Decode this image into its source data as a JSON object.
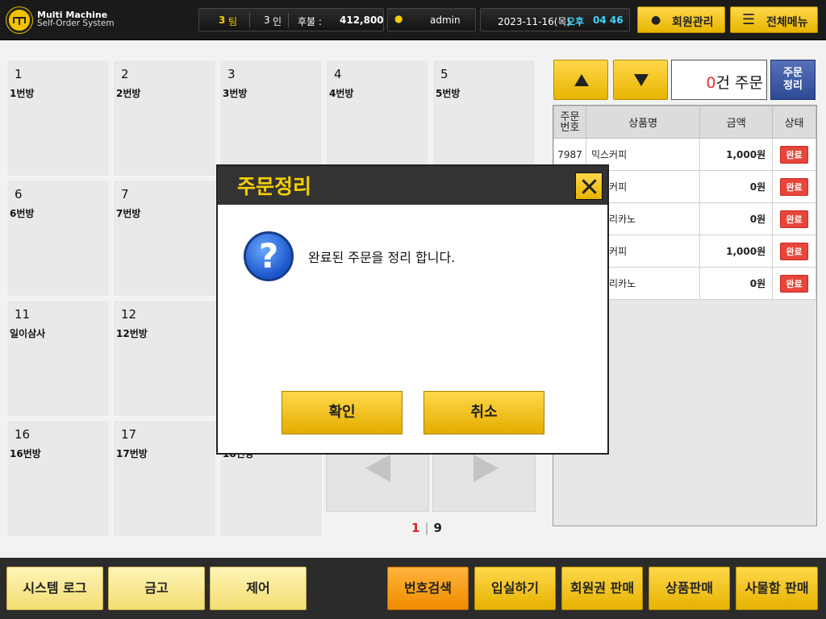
{
  "brand": {
    "line1": "Multi Machine",
    "line2": "Self-Order System"
  },
  "header": {
    "teams_value": "3",
    "teams_unit": "팀",
    "persons_value": "3",
    "persons_unit": "인",
    "postpaid_label": "후불 :",
    "postpaid_value": "412,800",
    "user": "admin",
    "date": "2023-11-16(목)",
    "ampm": "오후",
    "time": "04 46",
    "member_btn": "회원관리",
    "menu_btn": "전체메뉴"
  },
  "rooms": [
    {
      "num": "1",
      "name": "1번방"
    },
    {
      "num": "2",
      "name": "2번방"
    },
    {
      "num": "3",
      "name": "3번방"
    },
    {
      "num": "4",
      "name": "4번방"
    },
    {
      "num": "5",
      "name": "5번방"
    },
    {
      "num": "6",
      "name": "6번방"
    },
    {
      "num": "7",
      "name": "7번방"
    },
    {
      "num": "11",
      "name": "일이삼사"
    },
    {
      "num": "12",
      "name": "12번방"
    },
    {
      "num": "16",
      "name": "16번방"
    },
    {
      "num": "17",
      "name": "17번방"
    },
    {
      "num": "",
      "name": "18번방"
    }
  ],
  "pager": {
    "current": "1",
    "total": "9"
  },
  "orders_panel": {
    "count": "0",
    "count_suffix": "건 주문",
    "arrange_line1": "주문",
    "arrange_line2": "정리",
    "columns": {
      "no_line1": "주문",
      "no_line2": "번호",
      "product": "상품명",
      "amount": "금액",
      "status": "상태"
    },
    "rows": [
      {
        "no": "7987",
        "product": "믹스커피",
        "amount": "1,000원",
        "status": "완료"
      },
      {
        "no": "",
        "product": "믹스커피",
        "amount": "0원",
        "status": "완료"
      },
      {
        "no": "",
        "product": "아메리카노",
        "amount": "0원",
        "status": "완료"
      },
      {
        "no": "",
        "product": "믹스커피",
        "amount": "1,000원",
        "status": "완료"
      },
      {
        "no": "",
        "product": "아메리카노",
        "amount": "0원",
        "status": "완료"
      }
    ]
  },
  "bottom": {
    "system_log": "시스템 로그",
    "safe": "금고",
    "control": "제어",
    "number_search": "번호검색",
    "check_in": "입실하기",
    "membership_sale": "회원권 판매",
    "product_sale": "상품판매",
    "locker_sale": "사물함 판매"
  },
  "dialog": {
    "title": "주문정리",
    "message": "완료된 주문을 정리 합니다.",
    "confirm": "확인",
    "cancel": "취소"
  }
}
